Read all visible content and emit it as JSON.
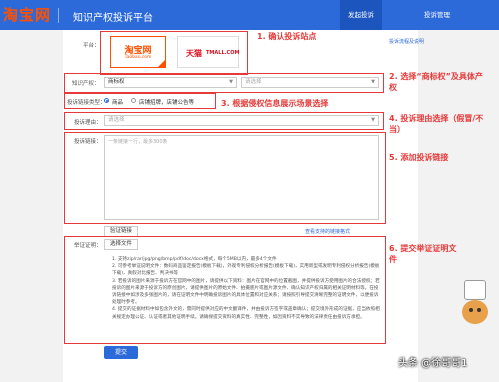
{
  "header": {
    "logo": "淘宝网",
    "title": "知识产权投诉平台",
    "nav": [
      "发起投诉",
      "投诉管理"
    ]
  },
  "form": {
    "platform_label": "平台：",
    "platforms": [
      {
        "name": "淘宝网",
        "sub": "Taobao.com"
      },
      {
        "name": "天猫",
        "sub": "TMALL.COM"
      }
    ],
    "process_link": "投诉流程及说明",
    "ip_label": "知识产权：",
    "ip_value": "商标权",
    "ip_placeholder": "请选择",
    "scene_label": "投诉链接类型：",
    "scene_options": [
      "商品",
      "店铺招牌，店铺公告等"
    ],
    "reason_label": "投诉理由：",
    "reason_placeholder": "请选择",
    "links_label": "投诉链接：",
    "links_placeholder": "一条链接一行，最多300条",
    "verify_button": "验证链接",
    "support_link": "查看支持的链接格式",
    "evidence_label": "举证证明：",
    "choose_file_button": "选择文件",
    "submit_button": "提交"
  },
  "tips": [
    "1. 支持zip/rar/jpg/png/bmp/pdf/doc/docx格式，每个5MB以内，最多4个文件",
    "2. 可参考举证说明文件：数码商品鉴定报告(模板下载)，外观专利侵权分析报告(模板下载)，实用新型或发明专利侵权分析报告(模板下载)，真假对比报告、判决书等",
    "3. 若投诉的图片来源于投诉方在官网中的图片，请提供以下资料：图片在官网中的位置截图，并提供投诉方使用图片的合法授权；若投诉的图片来源于投诉方的原创图片，请提供图片的原始文件、拍摄底片或图片源文件、确认知识产权归属的相关证明材料等。在投诉链接中如涉及多张图片的，请在证明文件中明确投诉图片的具体位置和对应关系；请按照引导提交清晰完整的证明文件，以便投诉处理时参考。",
    "4. 提交的证据材料中如包含外文的，需同时提供对应的中文翻译件，并由投诉方签字或盖章确认；提交境外形成的证据，应当依照相关规定办理公证、认证或者其他证明手续。请确保提交资料的真实性、完整性，如因资料不实导致的法律责任由投诉方承担。"
  ],
  "annotations": [
    "1. 确认投诉站点",
    "2. 选择“商标权”及具体产权",
    "3. 根据侵权信息展示场景选择",
    "4. 投诉理由选择（假冒/不当）",
    "5. 添加投诉链接",
    "6. 提交举证证明文件"
  ],
  "watermark": "头条 @徐哥哥1",
  "colors": {
    "brand_blue": "#2d6ad9",
    "taobao_orange": "#ff5000",
    "tmall_red": "#e00c1d",
    "annotation_red": "#e63a3a"
  }
}
